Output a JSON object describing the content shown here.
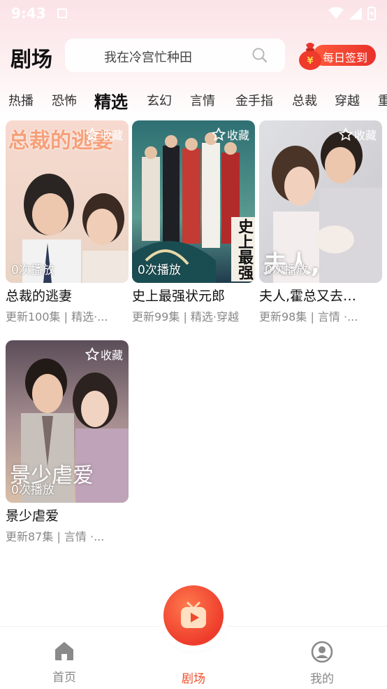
{
  "status_bar": {
    "time": "9:43"
  },
  "header": {
    "title": "剧场",
    "search_placeholder": "我在冷宫忙种田",
    "checkin_label": "每日签到"
  },
  "tabs": [
    {
      "label": "热播"
    },
    {
      "label": "恐怖"
    },
    {
      "label": "精选",
      "active": true
    },
    {
      "label": "玄幻"
    },
    {
      "label": "言情"
    },
    {
      "label": "金手指"
    },
    {
      "label": "总裁"
    },
    {
      "label": "穿越"
    },
    {
      "label": "重"
    }
  ],
  "dramas": [
    {
      "title": "总裁的逃妻",
      "meta": "更新100集 | 精选·...",
      "plays": "0次播放",
      "fav": "收藏",
      "poster_text": "总裁的逃妻"
    },
    {
      "title": "史上最强状元郎",
      "meta": "更新99集 | 精选·穿越",
      "plays": "0次播放",
      "fav": "收藏",
      "poster_text": "史上最强"
    },
    {
      "title": "夫人,霍总又去…",
      "meta": "更新98集 | 言情 ·...",
      "plays": "0次播放",
      "fav": "收藏",
      "poster_text": "夫人,"
    },
    {
      "title": "景少虐爱",
      "meta": "更新87集 | 言情 ·...",
      "plays": "0次播放",
      "fav": "收藏",
      "poster_text": "景少虐爱"
    }
  ],
  "bottom_nav": [
    {
      "label": "首页",
      "icon": "home-icon"
    },
    {
      "label": "剧场",
      "icon": "theater-icon",
      "active": true
    },
    {
      "label": "我的",
      "icon": "profile-icon"
    }
  ],
  "colors": {
    "accent": "#f0522f",
    "inactive": "#888888",
    "header_bg": "#fbe3e7"
  }
}
